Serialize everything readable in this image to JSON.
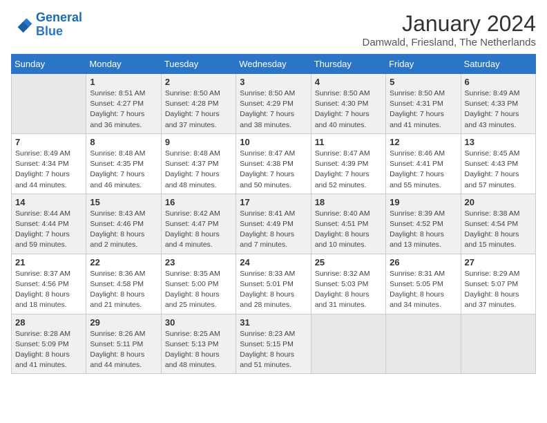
{
  "logo": {
    "line1": "General",
    "line2": "Blue"
  },
  "title": "January 2024",
  "subtitle": "Damwald, Friesland, The Netherlands",
  "weekdays": [
    "Sunday",
    "Monday",
    "Tuesday",
    "Wednesday",
    "Thursday",
    "Friday",
    "Saturday"
  ],
  "weeks": [
    [
      {
        "num": "",
        "info": ""
      },
      {
        "num": "1",
        "info": "Sunrise: 8:51 AM\nSunset: 4:27 PM\nDaylight: 7 hours\nand 36 minutes."
      },
      {
        "num": "2",
        "info": "Sunrise: 8:50 AM\nSunset: 4:28 PM\nDaylight: 7 hours\nand 37 minutes."
      },
      {
        "num": "3",
        "info": "Sunrise: 8:50 AM\nSunset: 4:29 PM\nDaylight: 7 hours\nand 38 minutes."
      },
      {
        "num": "4",
        "info": "Sunrise: 8:50 AM\nSunset: 4:30 PM\nDaylight: 7 hours\nand 40 minutes."
      },
      {
        "num": "5",
        "info": "Sunrise: 8:50 AM\nSunset: 4:31 PM\nDaylight: 7 hours\nand 41 minutes."
      },
      {
        "num": "6",
        "info": "Sunrise: 8:49 AM\nSunset: 4:33 PM\nDaylight: 7 hours\nand 43 minutes."
      }
    ],
    [
      {
        "num": "7",
        "info": "Sunrise: 8:49 AM\nSunset: 4:34 PM\nDaylight: 7 hours\nand 44 minutes."
      },
      {
        "num": "8",
        "info": "Sunrise: 8:48 AM\nSunset: 4:35 PM\nDaylight: 7 hours\nand 46 minutes."
      },
      {
        "num": "9",
        "info": "Sunrise: 8:48 AM\nSunset: 4:37 PM\nDaylight: 7 hours\nand 48 minutes."
      },
      {
        "num": "10",
        "info": "Sunrise: 8:47 AM\nSunset: 4:38 PM\nDaylight: 7 hours\nand 50 minutes."
      },
      {
        "num": "11",
        "info": "Sunrise: 8:47 AM\nSunset: 4:39 PM\nDaylight: 7 hours\nand 52 minutes."
      },
      {
        "num": "12",
        "info": "Sunrise: 8:46 AM\nSunset: 4:41 PM\nDaylight: 7 hours\nand 55 minutes."
      },
      {
        "num": "13",
        "info": "Sunrise: 8:45 AM\nSunset: 4:43 PM\nDaylight: 7 hours\nand 57 minutes."
      }
    ],
    [
      {
        "num": "14",
        "info": "Sunrise: 8:44 AM\nSunset: 4:44 PM\nDaylight: 7 hours\nand 59 minutes."
      },
      {
        "num": "15",
        "info": "Sunrise: 8:43 AM\nSunset: 4:46 PM\nDaylight: 8 hours\nand 2 minutes."
      },
      {
        "num": "16",
        "info": "Sunrise: 8:42 AM\nSunset: 4:47 PM\nDaylight: 8 hours\nand 4 minutes."
      },
      {
        "num": "17",
        "info": "Sunrise: 8:41 AM\nSunset: 4:49 PM\nDaylight: 8 hours\nand 7 minutes."
      },
      {
        "num": "18",
        "info": "Sunrise: 8:40 AM\nSunset: 4:51 PM\nDaylight: 8 hours\nand 10 minutes."
      },
      {
        "num": "19",
        "info": "Sunrise: 8:39 AM\nSunset: 4:52 PM\nDaylight: 8 hours\nand 13 minutes."
      },
      {
        "num": "20",
        "info": "Sunrise: 8:38 AM\nSunset: 4:54 PM\nDaylight: 8 hours\nand 15 minutes."
      }
    ],
    [
      {
        "num": "21",
        "info": "Sunrise: 8:37 AM\nSunset: 4:56 PM\nDaylight: 8 hours\nand 18 minutes."
      },
      {
        "num": "22",
        "info": "Sunrise: 8:36 AM\nSunset: 4:58 PM\nDaylight: 8 hours\nand 21 minutes."
      },
      {
        "num": "23",
        "info": "Sunrise: 8:35 AM\nSunset: 5:00 PM\nDaylight: 8 hours\nand 25 minutes."
      },
      {
        "num": "24",
        "info": "Sunrise: 8:33 AM\nSunset: 5:01 PM\nDaylight: 8 hours\nand 28 minutes."
      },
      {
        "num": "25",
        "info": "Sunrise: 8:32 AM\nSunset: 5:03 PM\nDaylight: 8 hours\nand 31 minutes."
      },
      {
        "num": "26",
        "info": "Sunrise: 8:31 AM\nSunset: 5:05 PM\nDaylight: 8 hours\nand 34 minutes."
      },
      {
        "num": "27",
        "info": "Sunrise: 8:29 AM\nSunset: 5:07 PM\nDaylight: 8 hours\nand 37 minutes."
      }
    ],
    [
      {
        "num": "28",
        "info": "Sunrise: 8:28 AM\nSunset: 5:09 PM\nDaylight: 8 hours\nand 41 minutes."
      },
      {
        "num": "29",
        "info": "Sunrise: 8:26 AM\nSunset: 5:11 PM\nDaylight: 8 hours\nand 44 minutes."
      },
      {
        "num": "30",
        "info": "Sunrise: 8:25 AM\nSunset: 5:13 PM\nDaylight: 8 hours\nand 48 minutes."
      },
      {
        "num": "31",
        "info": "Sunrise: 8:23 AM\nSunset: 5:15 PM\nDaylight: 8 hours\nand 51 minutes."
      },
      {
        "num": "",
        "info": ""
      },
      {
        "num": "",
        "info": ""
      },
      {
        "num": "",
        "info": ""
      }
    ]
  ]
}
